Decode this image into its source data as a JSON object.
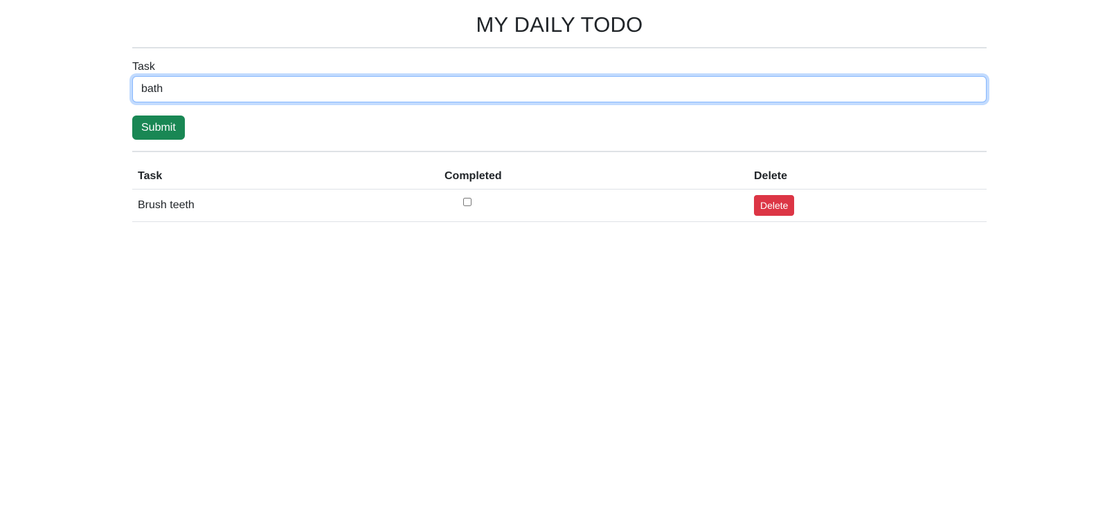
{
  "header": {
    "title": "MY DAILY TODO"
  },
  "form": {
    "task_label": "Task",
    "task_value": "bath",
    "submit_label": "Submit"
  },
  "table": {
    "columns": [
      "Task",
      "Completed",
      "Delete"
    ],
    "rows": [
      {
        "task": "Brush teeth",
        "completed": false,
        "delete_label": "Delete"
      }
    ]
  },
  "colors": {
    "submit": "#198754",
    "delete": "#dc3545",
    "focus_ring": "#86b7fe"
  }
}
